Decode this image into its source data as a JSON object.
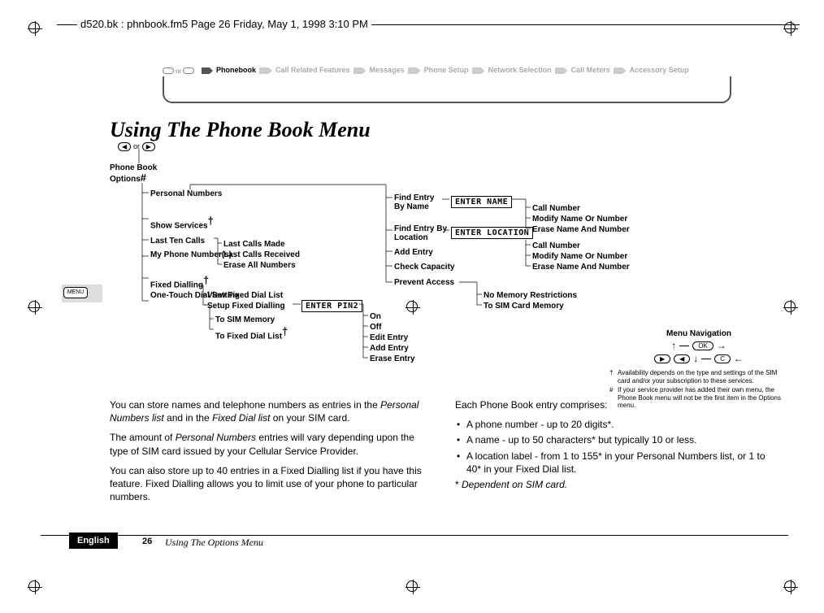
{
  "header": "d520.bk : phnbook.fm5  Page 26  Friday, May 1, 1998  3:10 PM",
  "nav": {
    "or": "or",
    "items": [
      "Phonebook",
      "Call Related Features",
      "Messages",
      "Phone Setup",
      "Network Selection",
      "Call Meters",
      "Accessory Setup"
    ]
  },
  "title": "Using The Phone Book Menu",
  "diagram": {
    "key_or": "or",
    "phone_book_options": "Phone Book Options",
    "hash": "#",
    "left": {
      "personal_numbers": "Personal Numbers",
      "show_services": "Show Services",
      "last_ten_calls": "Last Ten Calls",
      "my_phone_numbers": "My Phone Number(s)",
      "fixed_dialling": "Fixed Dialling",
      "one_touch": "One-Touch Dial Setting"
    },
    "last_calls": {
      "made": "Last Calls Made",
      "received": "Last Calls Received",
      "erase": "Erase All Numbers"
    },
    "fixed": {
      "view": "View Fixed Dial List",
      "setup": "Setup Fixed Dialling",
      "pin2": "ENTER PIN2"
    },
    "one_touch_sub": {
      "sim": "To SIM Memory",
      "fixed": "To Fixed Dial List"
    },
    "setup_fixed_sub": {
      "on": "On",
      "off": "Off",
      "edit": "Edit Entry",
      "add": "Add Entry",
      "erase": "Erase Entry"
    },
    "personal_sub": {
      "find_name": "Find Entry By Name",
      "enter_name": "ENTER NAME",
      "find_loc": "Find Entry By Location",
      "enter_loc": "ENTER LOCATION",
      "add": "Add Entry",
      "check": "Check Capacity",
      "prevent": "Prevent Access"
    },
    "name_actions": {
      "call": "Call Number",
      "modify": "Modify Name Or Number",
      "erase": "Erase Name And Number"
    },
    "loc_actions": {
      "call": "Call Number",
      "modify": "Modify Name Or Number",
      "erase": "Erase Name And Number"
    },
    "prevent_sub": {
      "no": "No Memory Restrictions",
      "sim": "To SIM Card Memory"
    },
    "dagger": "†"
  },
  "nav_legend": {
    "title": "Menu Navigation",
    "ok": "OK",
    "c": "C",
    "fn1": "Availability depends on the type and settings of the SIM card and/or your subscription to these services.",
    "fn2": "If your service provider has added their own menu, the Phone Book menu will not be the first item in the Options menu."
  },
  "body": {
    "p1a": "You can store names and telephone numbers as entries in the ",
    "p1b": "Personal Numbers list",
    "p1c": " and in the ",
    "p1d": "Fixed Dial list",
    "p1e": " on your SIM card.",
    "p2a": "The amount of ",
    "p2b": "Personal Numbers",
    "p2c": " entries will vary depending upon the type of SIM card issued by your Cellular Service Provider.",
    "p3": "You can also store up to 40 entries in a Fixed Dialling list if you have this feature. Fixed Dialling allows you to limit use of your phone to particular numbers.",
    "p4": "Each Phone Book entry comprises:",
    "li1": "A phone number - up to 20 digits*.",
    "li2": "A name - up to 50 characters* but typically 10 or less.",
    "li3": "A location label - from 1 to 155* in your Personal Numbers list, or 1 to 40* in your Fixed Dial list.",
    "p5a": "* ",
    "p5b": "Dependent on SIM card."
  },
  "footer": {
    "english": "English",
    "page": "26",
    "section": "Using The Options Menu"
  },
  "menu_key": "MENU"
}
